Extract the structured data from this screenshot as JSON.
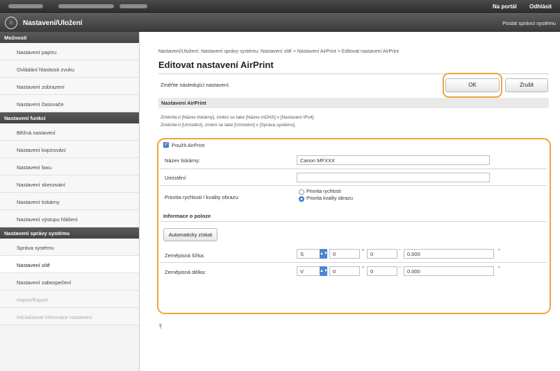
{
  "topbar": {
    "portal_link": "Na portál",
    "logout_link": "Odhlásit"
  },
  "titlebar": {
    "title": "Nastavení/Uložení",
    "admin_link": "Poslat správci systému",
    "icon": "home-icon"
  },
  "sidebar": {
    "sections": [
      {
        "heading": "Možnosti",
        "items": [
          {
            "label": "Nastavení papíru"
          },
          {
            "label": "Ovládání hlasitosti zvuku"
          },
          {
            "label": "Nastavení zobrazení"
          },
          {
            "label": "Nastavení časovače"
          }
        ]
      },
      {
        "heading": "Nastavení funkcí",
        "items": [
          {
            "label": "Běžná nastavení"
          },
          {
            "label": "Nastavení kopírování"
          },
          {
            "label": "Nastavení faxu"
          },
          {
            "label": "Nastavení skenování"
          },
          {
            "label": "Nastavení tiskárny"
          },
          {
            "label": "Nastavení výstupu hlášení"
          }
        ]
      },
      {
        "heading": "Nastavení správy systému",
        "items": [
          {
            "label": "Správa systému"
          },
          {
            "label": "Nastavení sítě"
          },
          {
            "label": "Nastavení zabezpečení"
          },
          {
            "label": "Import/Export"
          },
          {
            "label": "Inicializovat informace nastavení"
          }
        ]
      }
    ]
  },
  "main": {
    "breadcrumb": "Nastavení/Uložení: Nastavení správy systému: Nastavení sítě > Nastavení AirPrint > Editovat nastavení AirPrint",
    "page_title": "Editovat nastavení AirPrint",
    "instruction": "Změňte následující nastavení.",
    "ok_label": "OK",
    "cancel_label": "Zrušit",
    "section_heading": "Nastavení AirPrint",
    "info_line_1": "Změníte-li [Název tiskárny], změní se také [Název mDNS] v [Nastavení IPv4].",
    "info_line_2": "Změníte-li [Umístění], změní se také [Umístění] v [Správa systému].",
    "use_airprint_label": "Použít AirPrint",
    "use_airprint_checked": true,
    "printer_name_label": "Název tiskárny:",
    "printer_name_value": "Canon MFXXX",
    "location_label": "Umístění:",
    "location_value": "",
    "priority_label": "Priorita rychlosti / kvality obrazu:",
    "priority_options": [
      "Priorita rychlosti",
      "Priorita kvality obrazu"
    ],
    "priority_selected": "Priorita kvality obrazu",
    "position_heading": "Informace o poloze",
    "auto_get_label": "Automaticky získat",
    "latitude_label": "Zeměpisná šířka:",
    "latitude_dir": "S",
    "latitude_deg": "0",
    "latitude_min": "0",
    "latitude_sec": "0.000",
    "longitude_label": "Zeměpisná délka:",
    "longitude_dir": "V",
    "longitude_deg": "0",
    "longitude_min": "0",
    "longitude_sec": "0.000",
    "deg_unit": "°",
    "min_unit": "'",
    "sec_unit": "\"",
    "top_icon": "arrow-to-top-icon",
    "top_symbol": "⤒"
  },
  "colors": {
    "highlight": "#f2a23a",
    "accent": "#4a84d4"
  }
}
